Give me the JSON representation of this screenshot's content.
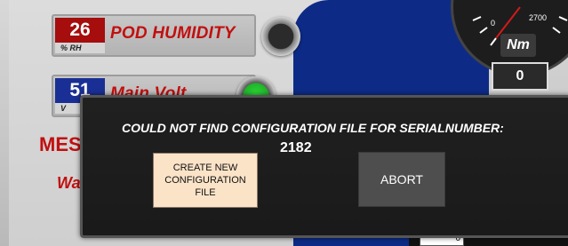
{
  "background": {
    "pod_humidity": {
      "value": "26",
      "unit": "% RH",
      "label": "POD HUMIDITY"
    },
    "main_volt": {
      "value": "51",
      "unit": "V",
      "label": "Main Volt"
    },
    "partial_label_1": "MES",
    "partial_label_2": "Wa",
    "gauge": {
      "scale_max": "2700",
      "unit": "Nm",
      "value": "0"
    },
    "bottom_field_value": "0"
  },
  "dialog": {
    "message": "COULD NOT FIND CONFIGURATION FILE FOR SERIALNUMBER:",
    "serial_number": "2182",
    "create_button_label": "CREATE NEW CONFIGURATION FILE",
    "abort_button_label": "ABORT"
  },
  "colors": {
    "dialog_bg": "#1e1e1e",
    "create_button_bg": "#fbe3c8",
    "abort_button_bg": "#4e4e4e",
    "label_red": "#c20f0f",
    "humidity_box": "#a60d0d",
    "volt_box": "#1a2f95",
    "indicator_green": "#2fe03a"
  }
}
